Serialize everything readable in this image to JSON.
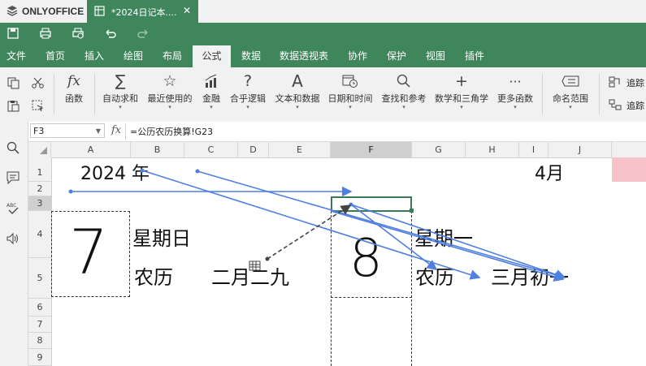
{
  "app": {
    "name": "ONLYOFFICE"
  },
  "tab": {
    "title": "*2024日记本....",
    "close": "✕"
  },
  "menu": {
    "items": [
      "文件",
      "首页",
      "插入",
      "绘图",
      "布局",
      "公式",
      "数据",
      "数据透视表",
      "协作",
      "保护",
      "视图",
      "插件"
    ],
    "active": "公式"
  },
  "ribbon": {
    "function_label": "函数",
    "buttons": [
      "自动求和",
      "最近使用的",
      "金融",
      "合乎逻辑",
      "文本和数据",
      "日期和时间",
      "查找和参考",
      "数学和三角学",
      "更多函数"
    ],
    "name_range_label": "命名范围",
    "trace_labels": [
      "追踪",
      "追踪"
    ]
  },
  "formula_bar": {
    "cell_ref": "F3",
    "fx": "fx",
    "formula": "=公历农历换算!G23"
  },
  "columns": [
    "A",
    "B",
    "C",
    "D",
    "E",
    "F",
    "G",
    "H",
    "I",
    "J"
  ],
  "selected_column": "F",
  "rows": [
    "1",
    "2",
    "3",
    "4",
    "5",
    "6",
    "7",
    "8",
    "9"
  ],
  "selected_row": "3",
  "cells": {
    "year": "2024 年",
    "month": "4月",
    "day1": "7",
    "weekday1": "星期日",
    "lunar_label1": "农历",
    "lunar_date1": "二月二九",
    "day2": "8",
    "weekday2": "星期一",
    "lunar_label2": "农历",
    "lunar_date2": "三月初一"
  },
  "colors": {
    "brand_green": "#40865c",
    "trace_arrow": "#4f7fe0",
    "pink_cell": "#f8c2cb"
  }
}
